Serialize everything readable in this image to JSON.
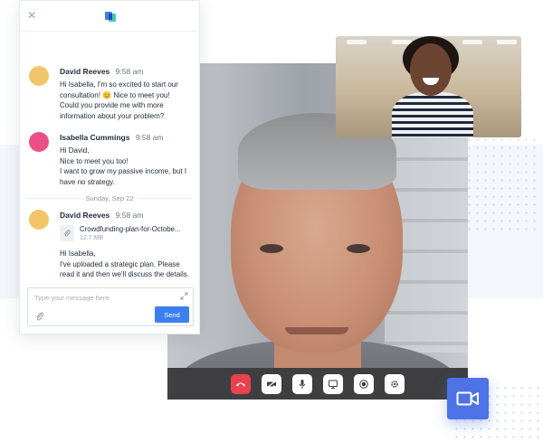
{
  "chat": {
    "close_icon": "close-icon",
    "logo_icon": "chat-logo-icon",
    "messages": [
      {
        "name": "David Reeves",
        "time": "9:58 am",
        "avatar_color": "#f3c56a",
        "text": "Hi Isabella, I'm so excited to start our consultation! 😊 Nice to meet you!\nCould you provide me with more information about your problem?"
      },
      {
        "name": "Isabella Cummings",
        "time": "9:58 am",
        "avatar_color": "#ec4f86",
        "text": "Hi David,\nNice to meet you too!\nI want to grow my passive income, but I have no strategy."
      }
    ],
    "day_separator": "Sunday, Sep 22",
    "message3": {
      "name": "David Reeves",
      "time": "9:58 am",
      "avatar_color": "#f3c56a",
      "file_name": "Crowdfunding-plan-for-Octobe...",
      "file_size": "12.7 MB",
      "text": "Hi Isabella,\nI've uploaded a strategic plan. Please read it and then we'll discuss the details."
    },
    "composer": {
      "placeholder": "Type your message here",
      "value": "",
      "send_label": "Send"
    }
  },
  "controls": [
    {
      "name": "end-call-button",
      "icon": "phone-hangup-icon"
    },
    {
      "name": "camera-toggle-button",
      "icon": "camera-off-icon"
    },
    {
      "name": "mic-toggle-button",
      "icon": "microphone-icon"
    },
    {
      "name": "screen-share-button",
      "icon": "screen-share-icon"
    },
    {
      "name": "record-button",
      "icon": "record-icon"
    },
    {
      "name": "settings-button",
      "icon": "gear-icon"
    }
  ],
  "colors": {
    "accent": "#3b7ff0",
    "end_call": "#e8424f",
    "badge": "#4d73e6",
    "control_bar": "#3f3f42"
  }
}
